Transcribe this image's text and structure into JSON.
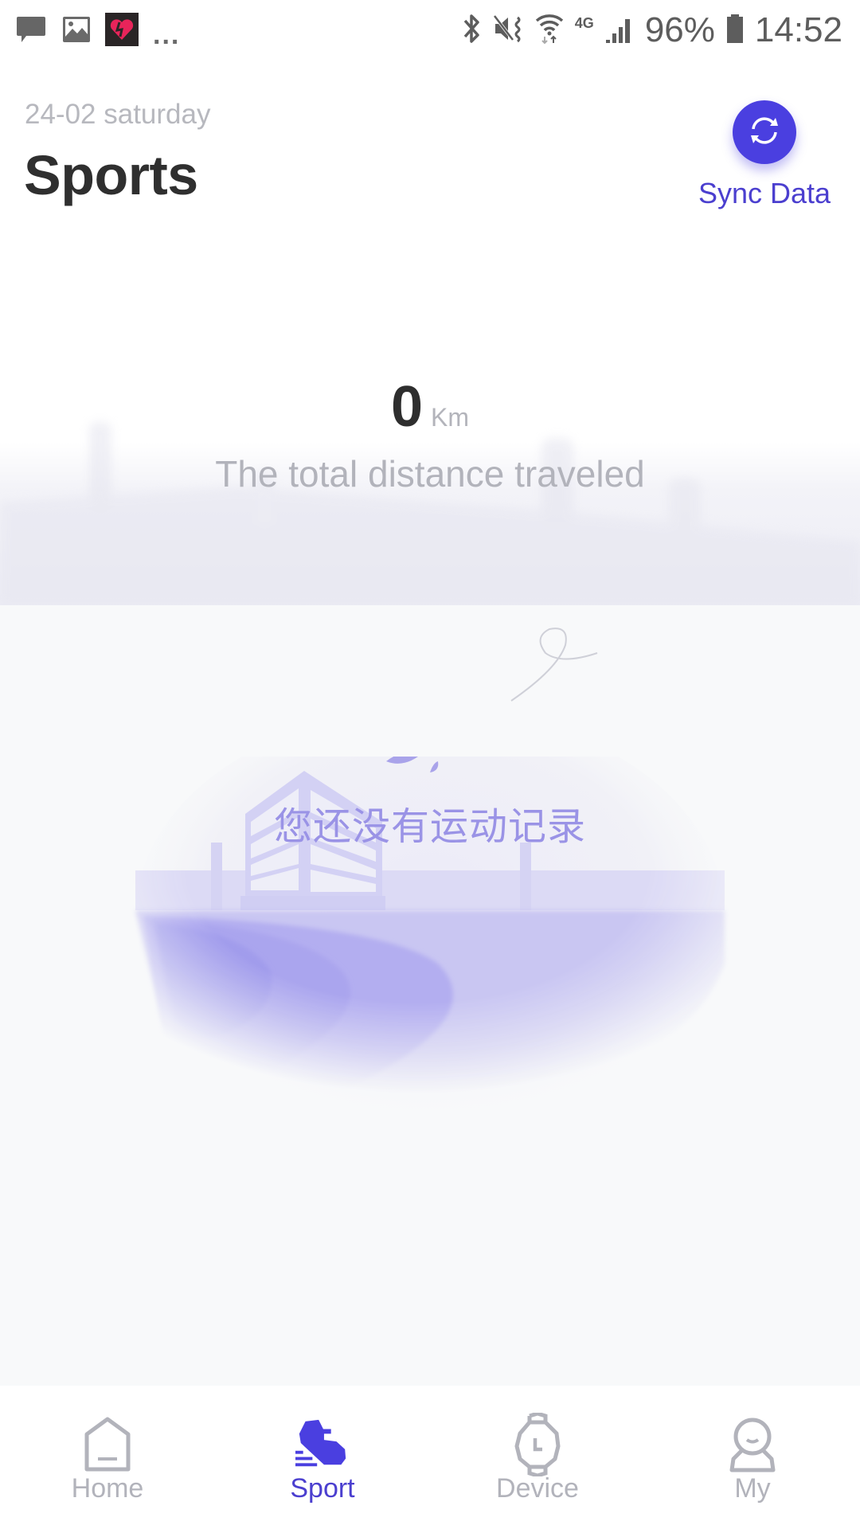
{
  "status_bar": {
    "notifications": [
      "message-icon",
      "image-icon",
      "app-heart-icon"
    ],
    "more": "...",
    "indicators": [
      "bluetooth-icon",
      "mute-vibrate-icon",
      "wifi-icon",
      "4g-icon",
      "signal-icon"
    ],
    "network": "4G",
    "battery": "96%",
    "time": "14:52"
  },
  "header": {
    "date": "24-02 saturday",
    "title": "Sports",
    "sync_label": "Sync Data"
  },
  "summary": {
    "distance_value": "0",
    "distance_unit": "Km",
    "caption": "The total distance traveled"
  },
  "empty_state": {
    "message": "您还没有运动记录"
  },
  "bottom_nav": {
    "items": [
      {
        "label": "Home",
        "icon": "home-icon",
        "active": false
      },
      {
        "label": "Sport",
        "icon": "sneaker-icon",
        "active": true
      },
      {
        "label": "Device",
        "icon": "watch-icon",
        "active": false
      },
      {
        "label": "My",
        "icon": "person-icon",
        "active": false
      }
    ]
  },
  "colors": {
    "accent": "#4a3fe0",
    "accent_text": "#4b3fcf",
    "muted_text": "#b2b3bb",
    "title_text": "#2f2f2f",
    "illustration": "#9a93e6"
  }
}
